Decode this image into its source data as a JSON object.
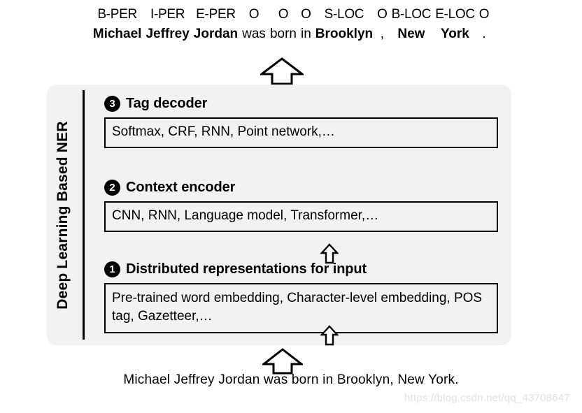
{
  "figure": {
    "title": "Deep Learning Based NER",
    "watermark": "https://blog.csdn.net/qq_43708647"
  },
  "tagged_sentence": {
    "tokens": [
      {
        "tag": "B-PER",
        "word": "Michael",
        "entity": true
      },
      {
        "tag": "I-PER",
        "word": "Jeffrey",
        "entity": true
      },
      {
        "tag": "E-PER",
        "word": "Jordan",
        "entity": true
      },
      {
        "tag": "O",
        "word": "was",
        "entity": false
      },
      {
        "tag": "O",
        "word": "born",
        "entity": false
      },
      {
        "tag": "O",
        "word": "in",
        "entity": false
      },
      {
        "tag": "S-LOC",
        "word": "Brooklyn",
        "entity": true
      },
      {
        "tag": "O",
        "word": ",",
        "entity": false
      },
      {
        "tag": "B-LOC",
        "word": "New",
        "entity": true
      },
      {
        "tag": "E-LOC",
        "word": "York",
        "entity": true
      },
      {
        "tag": "O",
        "word": ".",
        "entity": false
      }
    ]
  },
  "layers": [
    {
      "number": "3",
      "title": "Tag decoder",
      "contents": "Softmax, CRF, RNN, Point network,…"
    },
    {
      "number": "2",
      "title": "Context encoder",
      "contents": "CNN, RNN, Language model, Transformer,…"
    },
    {
      "number": "1",
      "title": "Distributed representations for input",
      "contents": "Pre-trained word embedding, Character-level embedding, POS tag, Gazetteer,…"
    }
  ],
  "input_sentence": {
    "text": "Michael  Jeffrey  Jordan  was  born  in  Brooklyn, New York."
  },
  "icons": {
    "arrow_up": "arrow-up-outline-icon"
  },
  "colors": {
    "panel_background": "#f2f2f2",
    "box_border": "#000000",
    "badge_background": "#000000",
    "badge_text": "#ffffff",
    "watermark_text": "#e3e3e3"
  }
}
